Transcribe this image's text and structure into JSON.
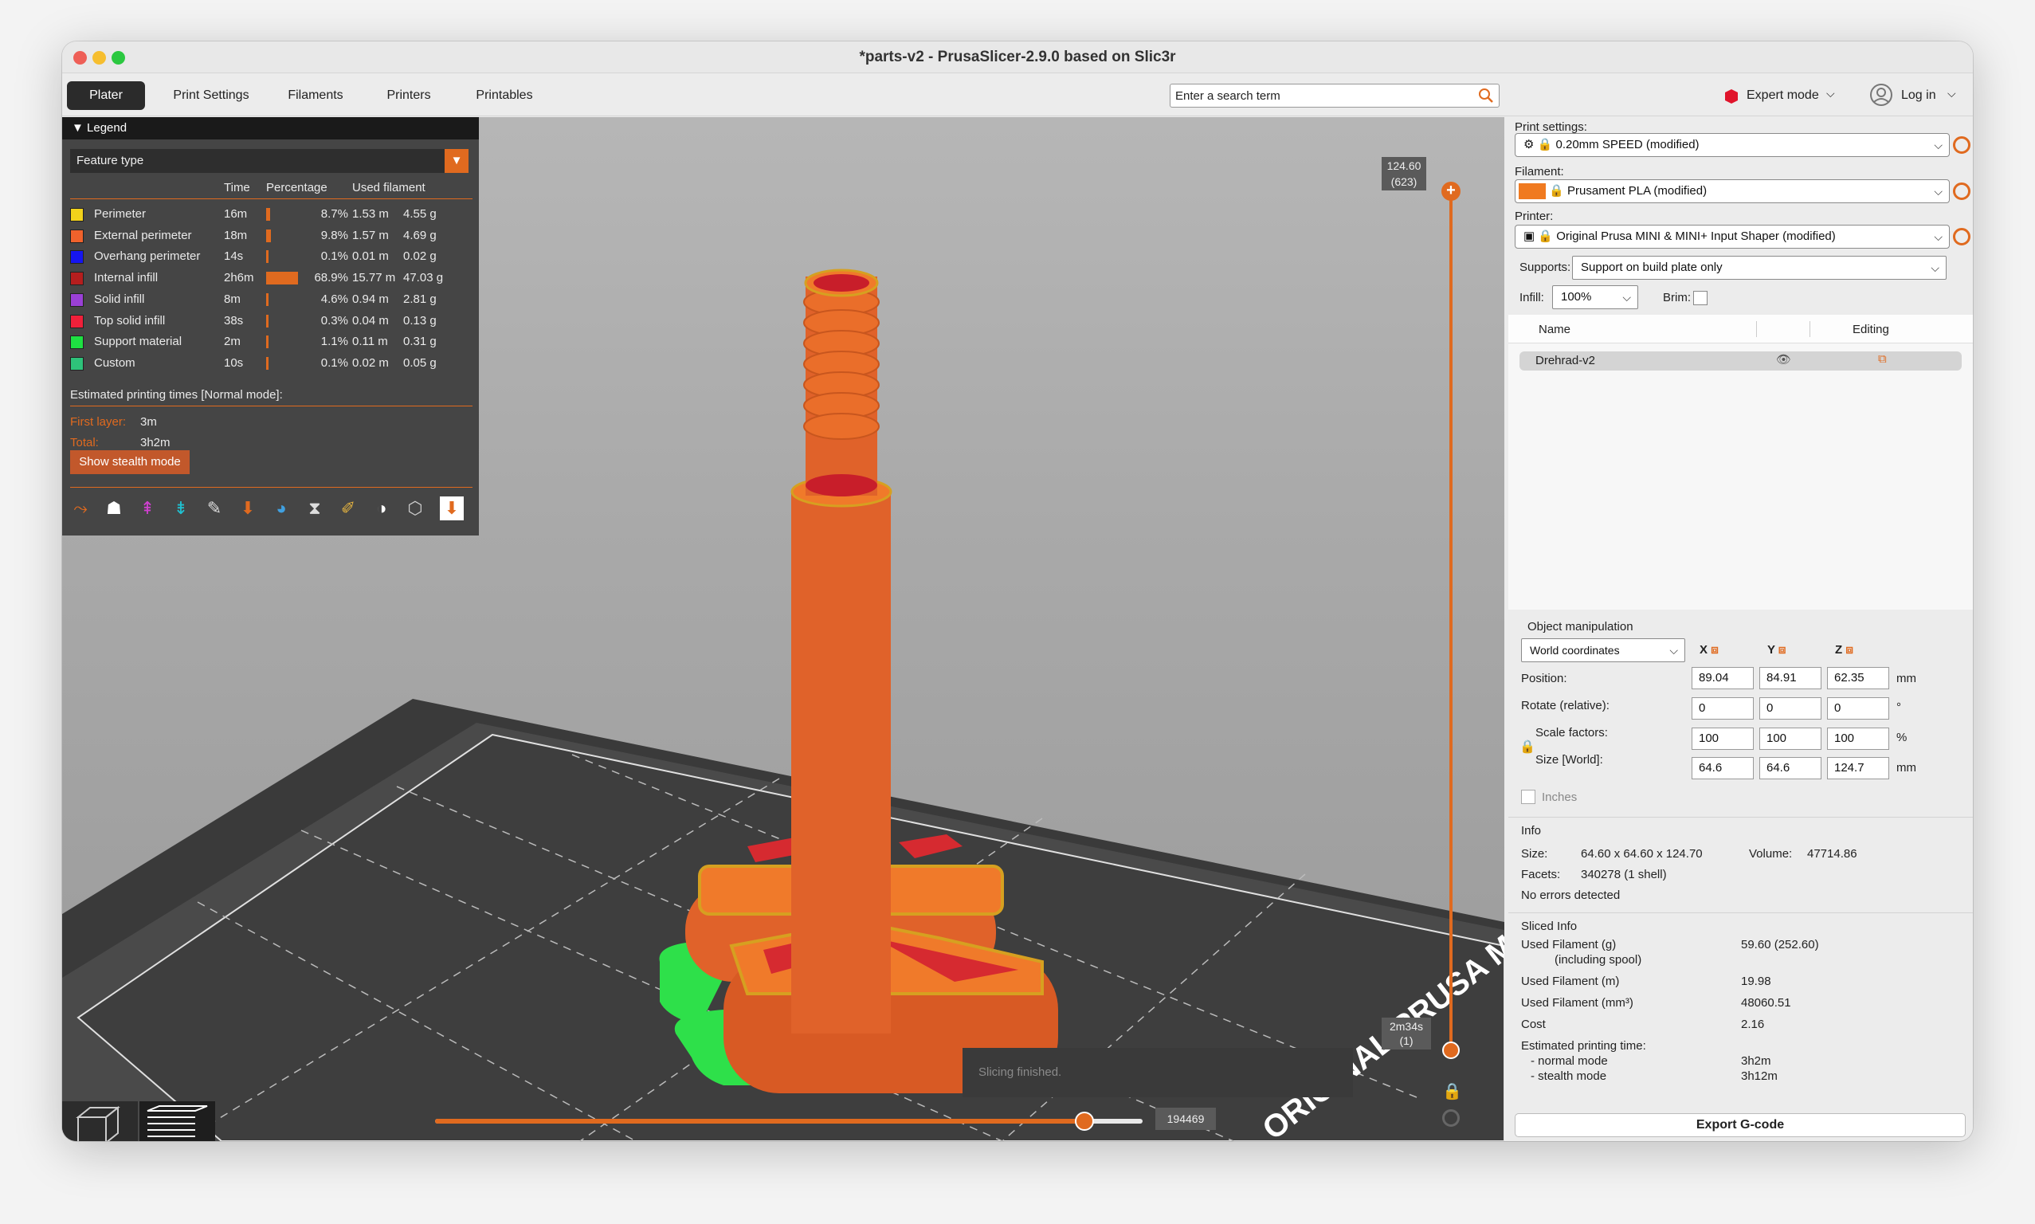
{
  "window": {
    "title": "*parts-v2 - PrusaSlicer-2.9.0 based on Slic3r"
  },
  "tabs": [
    "Plater",
    "Print Settings",
    "Filaments",
    "Printers",
    "Printables"
  ],
  "search": {
    "placeholder": "Enter a search term"
  },
  "header_right": {
    "expert": "Expert mode",
    "login": "Log in"
  },
  "legend": {
    "title": "Legend",
    "view_type": "Feature type",
    "columns": {
      "time": "Time",
      "percentage": "Percentage",
      "used": "Used filament"
    },
    "rows": [
      {
        "name": "Perimeter",
        "color": "#f2d21b",
        "time": "16m",
        "pct": "8.7%",
        "pct_value": 8.7,
        "len": "1.53 m",
        "weight": "4.55 g"
      },
      {
        "name": "External perimeter",
        "color": "#f0622c",
        "time": "18m",
        "pct": "9.8%",
        "pct_value": 9.8,
        "len": "1.57 m",
        "weight": "4.69 g"
      },
      {
        "name": "Overhang perimeter",
        "color": "#1515f0",
        "time": "14s",
        "pct": "0.1%",
        "pct_value": 0.1,
        "len": "0.01 m",
        "weight": "0.02 g"
      },
      {
        "name": "Internal infill",
        "color": "#b51e1e",
        "time": "2h6m",
        "pct": "68.9%",
        "pct_value": 68.9,
        "len": "15.77 m",
        "weight": "47.03 g"
      },
      {
        "name": "Solid infill",
        "color": "#9a40d6",
        "time": "8m",
        "pct": "4.6%",
        "pct_value": 4.6,
        "len": "0.94 m",
        "weight": "2.81 g"
      },
      {
        "name": "Top solid infill",
        "color": "#f0203a",
        "time": "38s",
        "pct": "0.3%",
        "pct_value": 0.3,
        "len": "0.04 m",
        "weight": "0.13 g"
      },
      {
        "name": "Support material",
        "color": "#1ee042",
        "time": "2m",
        "pct": "1.1%",
        "pct_value": 1.1,
        "len": "0.11 m",
        "weight": "0.31 g"
      },
      {
        "name": "Custom",
        "color": "#2ec27a",
        "time": "10s",
        "pct": "0.1%",
        "pct_value": 0.1,
        "len": "0.02 m",
        "weight": "0.05 g"
      }
    ],
    "estimated": "Estimated printing times [Normal mode]:",
    "first_layer_label": "First layer:",
    "first_layer": "3m",
    "total_label": "Total:",
    "total": "3h2m",
    "stealth_button": "Show stealth mode"
  },
  "viewport": {
    "vslider_top_value": "124.60",
    "vslider_top_layer": "(623)",
    "vslider_bottom_value": "2m34s",
    "vslider_bottom_layer": "(1)",
    "hslider_value": "194469",
    "hslider_fraction": 0.918,
    "notification": "Slicing finished.",
    "bed_text": "ORIGINAL PRUSA MI"
  },
  "sidebar": {
    "print_settings_label": "Print settings:",
    "print_settings": "0.20mm SPEED (modified)",
    "filament_label": "Filament:",
    "filament": "Prusament PLA (modified)",
    "filament_color": "#f07a20",
    "printer_label": "Printer:",
    "printer": "Original Prusa MINI & MINI+ Input Shaper (modified)",
    "supports_label": "Supports:",
    "supports": "Support on build plate only",
    "infill_label": "Infill:",
    "infill": "100%",
    "brim_label": "Brim:",
    "col_name": "Name",
    "col_editing": "Editing",
    "object_name": "Drehrad-v2",
    "om_title": "Object manipulation",
    "coords": "World coordinates",
    "axes": [
      "X",
      "Y",
      "Z"
    ],
    "position_label": "Position:",
    "position": [
      "89.04",
      "84.91",
      "62.35"
    ],
    "position_unit": "mm",
    "rotate_label": "Rotate (relative):",
    "rotate": [
      "0",
      "0",
      "0"
    ],
    "rotate_unit": "°",
    "scale_label": "Scale factors:",
    "scale": [
      "100",
      "100",
      "100"
    ],
    "scale_unit": "%",
    "size_label": "Size [World]:",
    "size": [
      "64.6",
      "64.6",
      "124.7"
    ],
    "size_unit": "mm",
    "inches": "Inches",
    "info_title": "Info",
    "size_info_label": "Size:",
    "size_info": "64.60 x 64.60 x 124.70",
    "volume_label": "Volume:",
    "volume": "47714.86",
    "facets_label": "Facets:",
    "facets": "340278 (1 shell)",
    "no_errors": "No errors detected",
    "sliced_title": "Sliced Info",
    "sliced": [
      {
        "label": "Used Filament (g)",
        "value": "59.60 (252.60)"
      },
      {
        "label": "(including spool)",
        "value": ""
      },
      {
        "label": "Used Filament (m)",
        "value": "19.98"
      },
      {
        "label": "Used Filament (mm³)",
        "value": "48060.51"
      },
      {
        "label": "Cost",
        "value": "2.16"
      },
      {
        "label": "Estimated printing time:",
        "value": ""
      },
      {
        "label": "- normal mode",
        "value": "3h2m"
      },
      {
        "label": "- stealth mode",
        "value": "3h12m"
      }
    ],
    "export": "Export G-code"
  }
}
